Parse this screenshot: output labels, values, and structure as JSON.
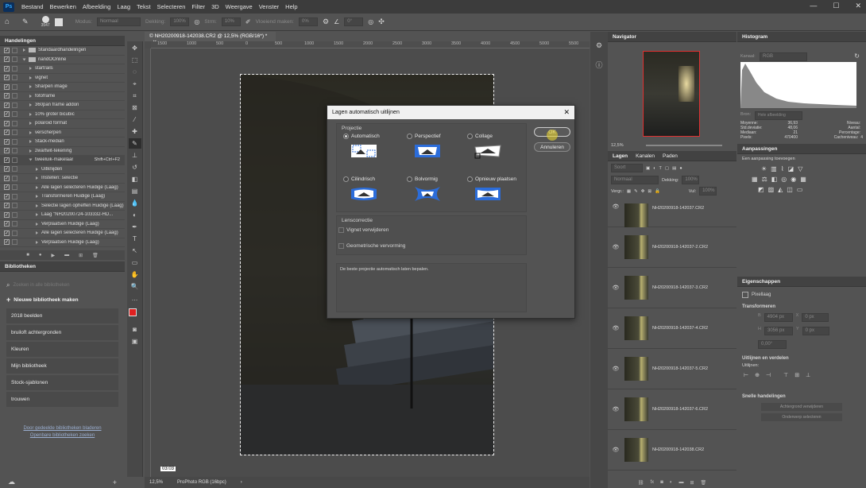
{
  "menubar": {
    "items": [
      "Bestand",
      "Bewerken",
      "Afbeelding",
      "Laag",
      "Tekst",
      "Selecteren",
      "Filter",
      "3D",
      "Weergave",
      "Venster",
      "Help"
    ],
    "logo": "Ps"
  },
  "options": {
    "brush_size": "3547",
    "mode_label": "Modus:",
    "mode_value": "Normaal",
    "opacity_label": "Dekking:",
    "opacity_value": "100%",
    "flow_label": "Strm:",
    "flow_value": "10%",
    "smooth_label": "Vloeiend maken:",
    "smooth_value": "0%",
    "angle_value": "0°"
  },
  "actions": {
    "title": "Handelingen",
    "rows": [
      {
        "label": "Standaardhandelingen",
        "kind": "folder",
        "open": false
      },
      {
        "label": "nandOOnline",
        "kind": "folder",
        "open": true
      },
      {
        "label": "startrails",
        "kind": "item"
      },
      {
        "label": "vignet",
        "kind": "item"
      },
      {
        "label": "Sharpen image",
        "kind": "item"
      },
      {
        "label": "fotoframe",
        "kind": "item"
      },
      {
        "label": "360pan frame addon",
        "kind": "item"
      },
      {
        "label": "10% groter bicubic",
        "kind": "item"
      },
      {
        "label": "polaroid format",
        "kind": "item"
      },
      {
        "label": "verscherpen",
        "kind": "item"
      },
      {
        "label": "Stack-median",
        "kind": "item"
      },
      {
        "label": "zwartwit-tekening",
        "kind": "item"
      },
      {
        "label": "tweeluik-makelaar",
        "kind": "item",
        "shortcut": "Shift+Ctrl+F2",
        "open": true
      },
      {
        "label": "Uitknijden",
        "kind": "sub"
      },
      {
        "label": "Instellen: selectie",
        "kind": "sub"
      },
      {
        "label": "Alle lagen selecteren Huidige (Laag)",
        "kind": "sub"
      },
      {
        "label": "Transformeren Huidige (Laag)",
        "kind": "sub"
      },
      {
        "label": "Selectie lagen opheffen Huidige (Laag)",
        "kind": "sub"
      },
      {
        "label": "Laag \"NH20200724-103332-HD...",
        "kind": "sub"
      },
      {
        "label": "Verplaatsen Huidige (Laag)",
        "kind": "sub"
      },
      {
        "label": "Alle lagen selecteren Huidige (Laag)",
        "kind": "sub"
      },
      {
        "label": "Verplaatsen Huidige (Laag)",
        "kind": "sub"
      }
    ]
  },
  "libraries": {
    "title": "Bibliotheken",
    "search_placeholder": "Zoeken in alle bibliotheken",
    "new_label": "Nieuwe bibliotheek maken",
    "items": [
      "2018 beelden",
      "bruiloft achtergronden",
      "Kleuren",
      "Mijn bibliotheek",
      "Stock-sjablonen",
      "trouwen"
    ],
    "link1": "Door gedeelde bibliotheken bladeren",
    "link2": "Openbare bibliotheken zoeken"
  },
  "document": {
    "tab_title": "© NH20200918-142038.CR2 @ 12,5% (RGB/16*) *",
    "ruler_ticks": [
      "1500",
      "1000",
      "500",
      "0",
      "500",
      "1000",
      "1500",
      "2000",
      "2500",
      "3000",
      "3500",
      "4000",
      "4500",
      "5000",
      "5500"
    ],
    "zoom": "12,5%",
    "profile": "ProPhoto RGB (16bpc)",
    "tooltip": "03:03"
  },
  "dialog": {
    "title": "Lagen automatisch uitlijnen",
    "projection_label": "Projectie",
    "options": [
      "Automatisch",
      "Perspectief",
      "Collage",
      "Cilindrisch",
      "Bolvormig",
      "Opnieuw plaatsen"
    ],
    "selected": "Automatisch",
    "lens_label": "Lenscorrectie",
    "vignet_label": "Vignet verwijderen",
    "geo_label": "Geometrische vervorming",
    "description": "De beste projectie automatisch laten bepalen.",
    "ok_label": "OK",
    "cancel_label": "Annuleren"
  },
  "navigator": {
    "title": "Navigator",
    "zoom": "12,5%"
  },
  "histogram": {
    "title": "Histogram",
    "channel_label": "Kanaal:",
    "channel_value": "RGB",
    "source_label": "Bron:",
    "source_value": "Hele afbeelding",
    "stats_left": [
      [
        "Moyenne:",
        "36,93"
      ],
      [
        "Std.deviatie:",
        "48,06"
      ],
      [
        "Mediaan:",
        "21"
      ],
      [
        "Pixels:",
        "470400"
      ]
    ],
    "stats_right": [
      [
        "Niveau:",
        ""
      ],
      [
        "Aantal:",
        ""
      ],
      [
        "Percentage:",
        ""
      ],
      [
        "Cacheniveau:",
        "4"
      ]
    ]
  },
  "adjustments": {
    "title": "Aanpassingen",
    "subtitle": "Een aanpassing toevoegen"
  },
  "properties": {
    "title": "Eigenschappen",
    "kind": "Pixellaag",
    "transform_label": "Transformeren",
    "w_label": "B",
    "w_value": "4904 px",
    "h_label": "H",
    "h_value": "3056 px",
    "x_label": "X",
    "x_value": "0 px",
    "y_label": "Y",
    "y_value": "0 px",
    "angle_value": "0,00°",
    "align_label": "Uitlijnen en verdelen",
    "align_sub": "Uitlijnen:",
    "quick_label": "Snelle handelingen",
    "btn1": "Achtergrond verwijderen",
    "btn2": "Onderwerp selecteren"
  },
  "layers": {
    "tabs": [
      "Lagen",
      "Kanalen",
      "Paden"
    ],
    "search_placeholder": "Soort",
    "blend_value": "Normaal",
    "opacity_label": "Dekking:",
    "opacity_value": "100%",
    "lock_label": "Vergr.:",
    "fill_label": "Vul:",
    "fill_value": "100%",
    "items": [
      "NH20200918-142037.CR2",
      "NH20200918-142037-2.CR2",
      "NH20200918-142037-3.CR2",
      "NH20200918-142037-4.CR2",
      "NH20200918-142037-5.CR2",
      "NH20200918-142037-6.CR2",
      "NH20200918-142038.CR2"
    ]
  }
}
